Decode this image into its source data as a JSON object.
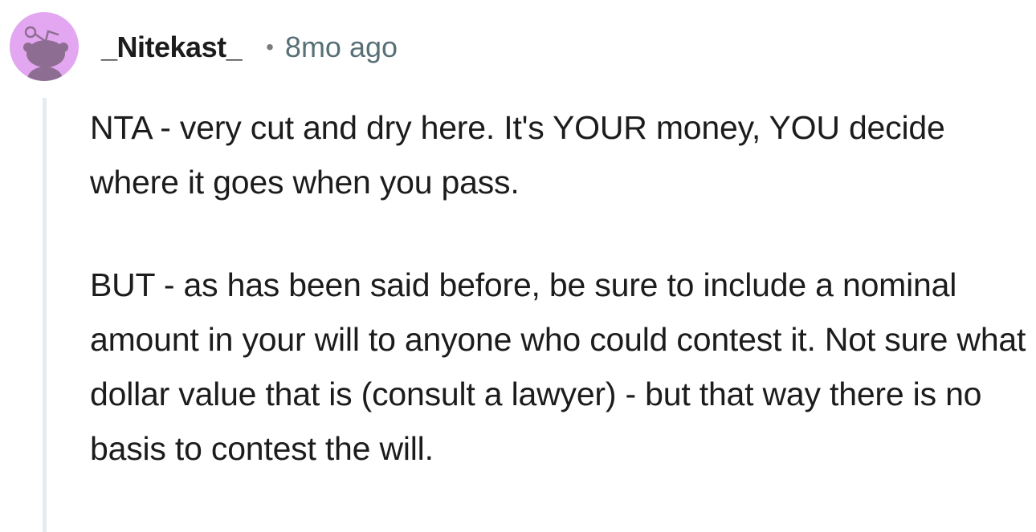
{
  "comment": {
    "username": "_Nitekast_",
    "separator": "•",
    "timestamp": "8mo ago",
    "avatar_icon": "reddit-snoo-avatar-icon",
    "avatar_color": "#e2a7f0",
    "paragraphs": [
      "NTA - very cut and dry here. It's YOUR money, YOU decide where it goes when you pass.",
      "BUT - as has been said before, be sure to include a nominal amount in your will to anyone who could contest it. Not sure what dollar value that is (consult a lawyer) - but that way there is no basis to contest the will."
    ]
  }
}
